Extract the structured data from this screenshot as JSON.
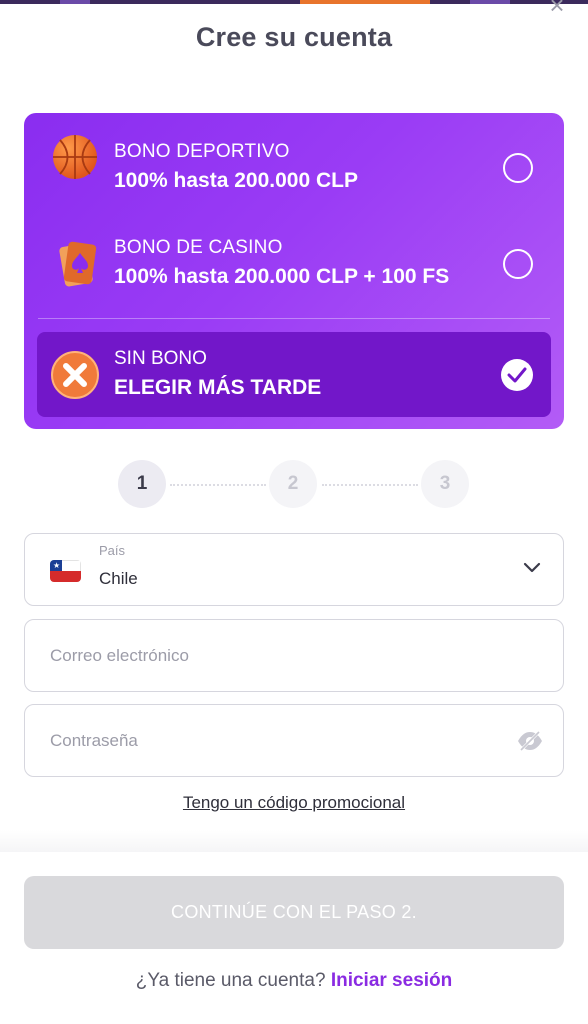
{
  "header": {
    "title": "Cree su cuenta",
    "close_icon": "close-icon"
  },
  "bonus": {
    "options": [
      {
        "label": "BONO DEPORTIVO",
        "value": "100% hasta 200.000 CLP",
        "icon": "basketball-icon",
        "selected": false
      },
      {
        "label": "BONO DE CASINO",
        "value": "100% hasta 200.000 CLP + 100 FS",
        "icon": "playing-card-icon",
        "selected": false
      },
      {
        "label": "SIN BONO",
        "value": "ELEGIR MÁS TARDE",
        "icon": "no-bonus-icon",
        "selected": true
      }
    ]
  },
  "stepper": {
    "steps": [
      "1",
      "2",
      "3"
    ],
    "current": 1
  },
  "form": {
    "country": {
      "label": "País",
      "value": "Chile",
      "flag": "chile-flag-icon"
    },
    "email": {
      "placeholder": "Correo electrónico"
    },
    "password": {
      "placeholder": "Contraseña"
    },
    "promo_link": "Tengo un código promocional"
  },
  "footer": {
    "continue_label": "CONTINÚE CON EL PASO 2.",
    "have_account": "¿Ya tiene una cuenta?",
    "login_label": "Iniciar sesión"
  },
  "colors": {
    "accent": "#8a2be2",
    "card_gradient_start": "#8a2df0",
    "card_gradient_end": "#b35cf6",
    "selected_row": "#7217c9",
    "disabled_button": "#d9d9dc"
  }
}
